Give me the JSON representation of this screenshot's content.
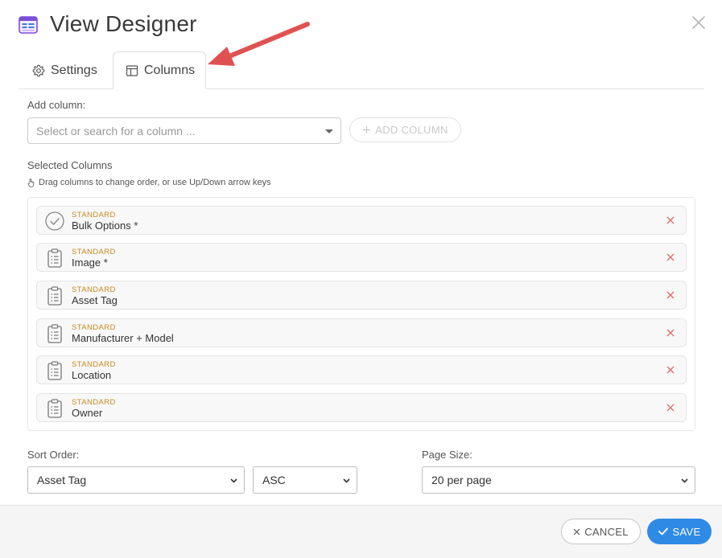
{
  "dialog": {
    "title": "View Designer",
    "title_icon": "view-designer-icon",
    "close_icon": "close-icon"
  },
  "tabs": [
    {
      "label": "Settings",
      "icon": "gear-icon",
      "active": false
    },
    {
      "label": "Columns",
      "icon": "columns-icon",
      "active": true
    }
  ],
  "add_column": {
    "label": "Add column:",
    "placeholder": "Select or search for a column ...",
    "button_label": "ADD COLUMN",
    "button_disabled": true
  },
  "selected_columns": {
    "title": "Selected Columns",
    "hint": "Drag columns to change order, or use Up/Down arrow keys",
    "items": [
      {
        "category": "STANDARD",
        "name": "Bulk Options *",
        "icon": "check-circle-icon"
      },
      {
        "category": "STANDARD",
        "name": "Image *",
        "icon": "clipboard-icon"
      },
      {
        "category": "STANDARD",
        "name": "Asset Tag",
        "icon": "clipboard-icon"
      },
      {
        "category": "STANDARD",
        "name": "Manufacturer + Model",
        "icon": "clipboard-icon"
      },
      {
        "category": "STANDARD",
        "name": "Location",
        "icon": "clipboard-icon"
      },
      {
        "category": "STANDARD",
        "name": "Owner",
        "icon": "clipboard-icon"
      }
    ]
  },
  "sort": {
    "label": "Sort Order:",
    "field_value": "Asset Tag",
    "direction_value": "ASC"
  },
  "page_size": {
    "label": "Page Size:",
    "value": "20 per page"
  },
  "footer": {
    "cancel_label": "CANCEL",
    "save_label": "SAVE"
  },
  "colors": {
    "accent": "#2f8ae5",
    "category": "#c8891f",
    "remove": "#e06b6b",
    "annotation_arrow": "#e05252"
  }
}
